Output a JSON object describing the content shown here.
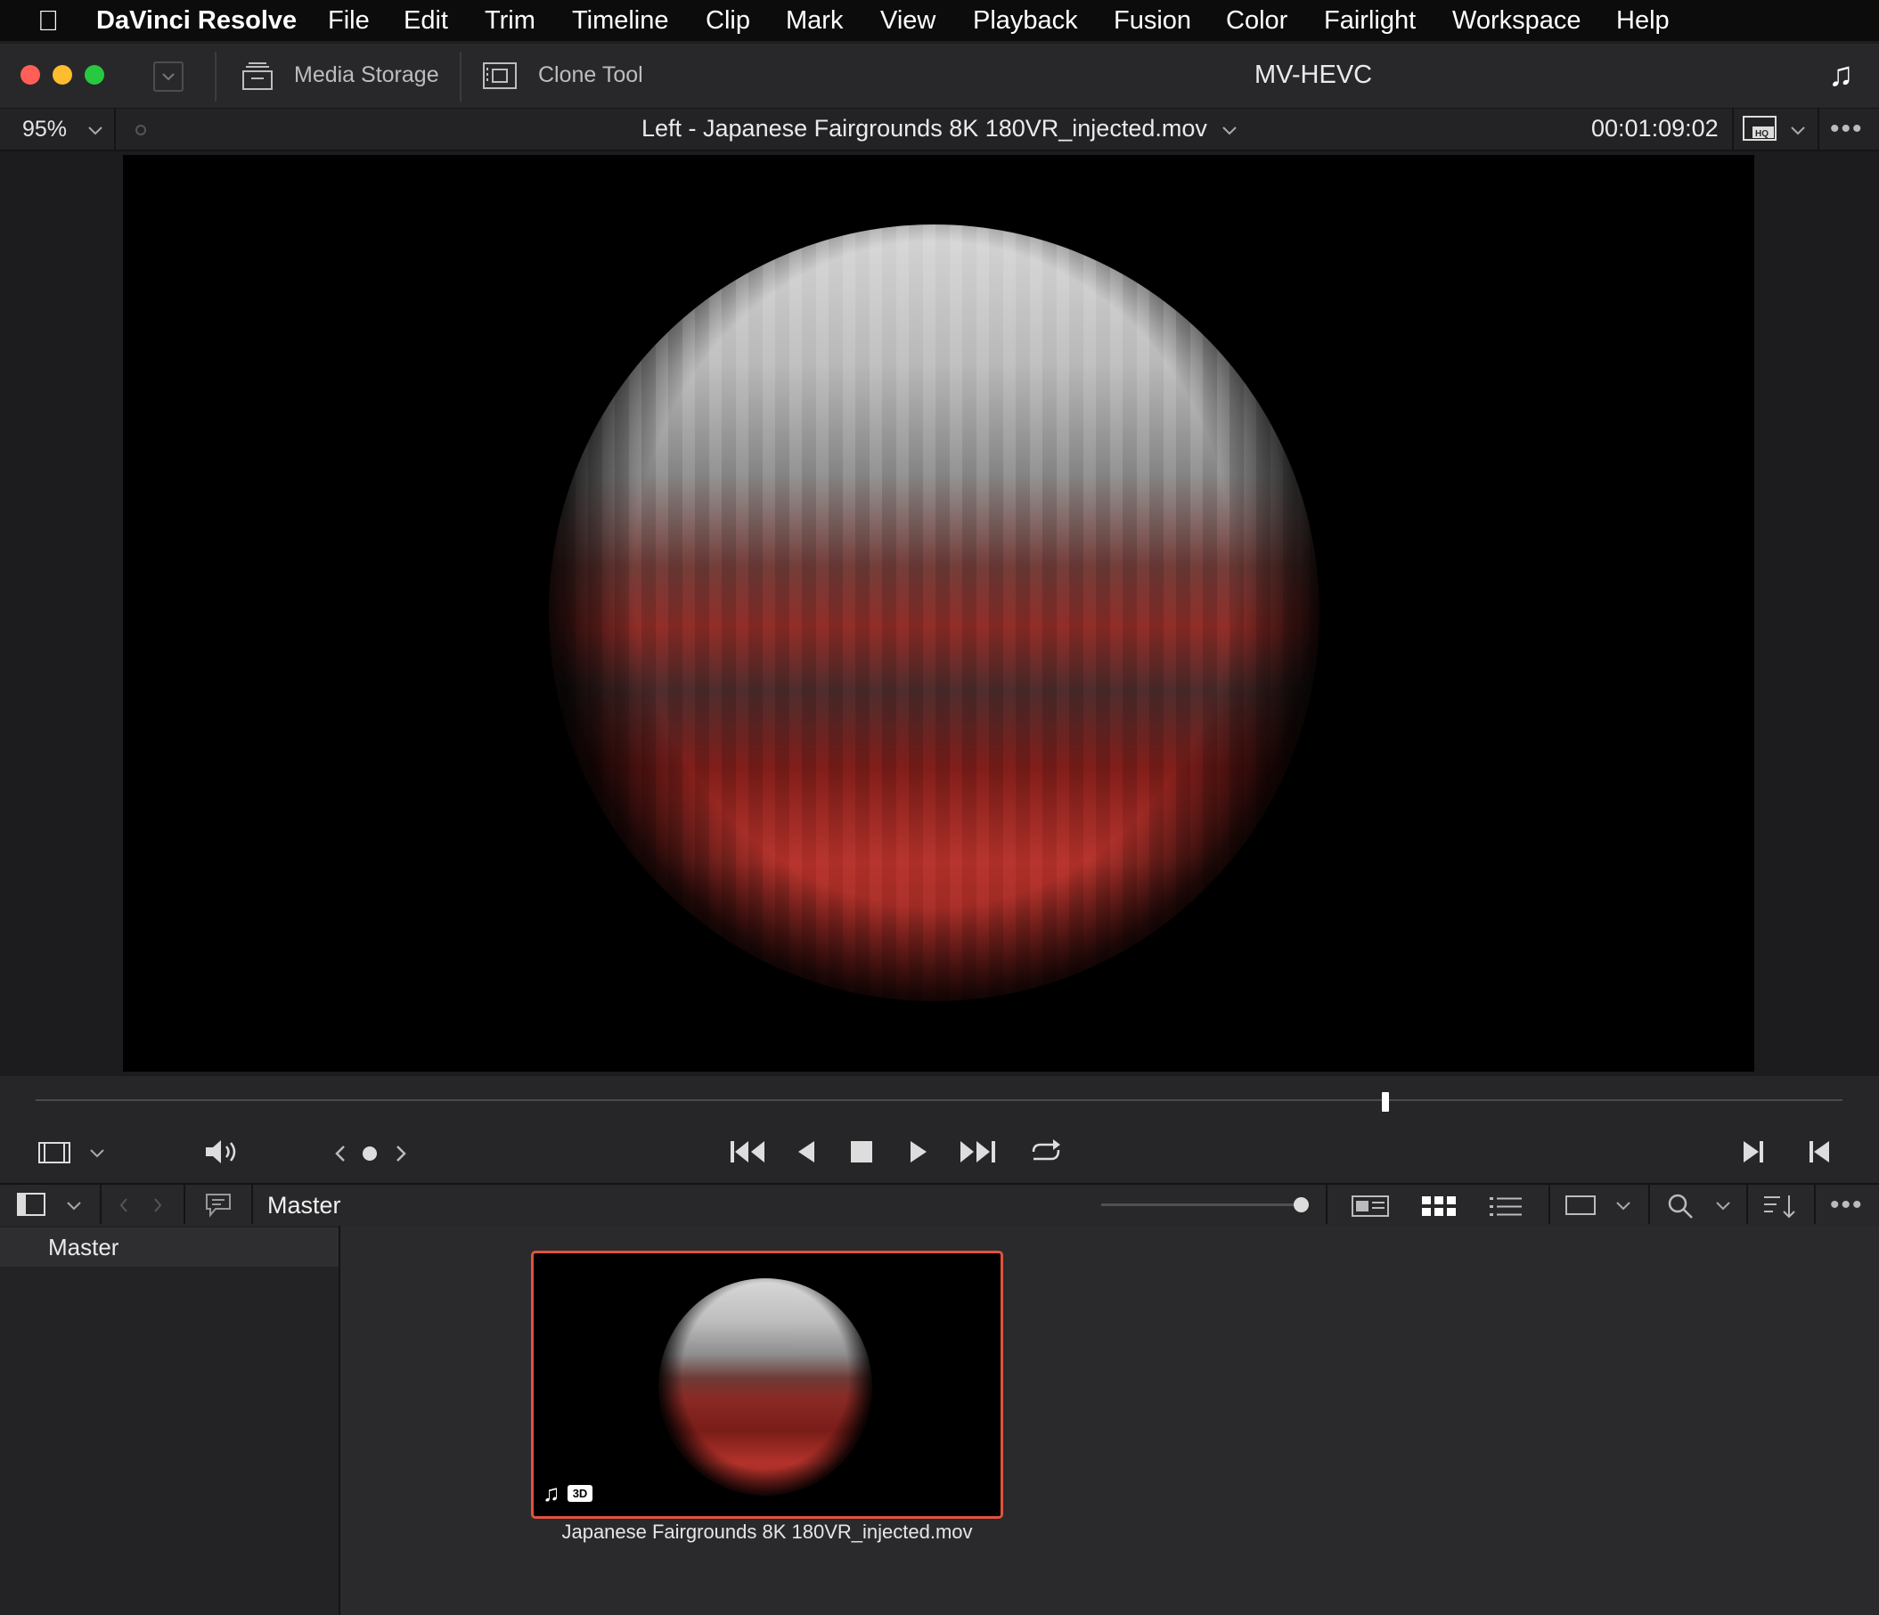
{
  "menubar": {
    "app_name": "DaVinci Resolve",
    "items": [
      "File",
      "Edit",
      "Trim",
      "Timeline",
      "Clip",
      "Mark",
      "View",
      "Playback",
      "Fusion",
      "Color",
      "Fairlight",
      "Workspace",
      "Help"
    ]
  },
  "titlebar": {
    "media_storage_label": "Media Storage",
    "clone_tool_label": "Clone Tool",
    "project_title": "MV-HEVC"
  },
  "viewer": {
    "zoom": "95%",
    "clip_name": "Left - Japanese Fairgrounds 8K 180VR_injected.mov",
    "timecode": "00:01:09:02"
  },
  "transport": {
    "playhead_fraction": 0.747
  },
  "media_pool": {
    "current_bin": "Master",
    "bins": [
      "Master"
    ],
    "clips": [
      {
        "name": "Japanese Fairgrounds 8K 180VR_injected.mov",
        "badge": "3D",
        "selected": true
      }
    ]
  },
  "colors": {
    "accent_selection": "#e0533e",
    "close": "#ff5f57",
    "minimize": "#febc2e",
    "zoom": "#28c840"
  }
}
